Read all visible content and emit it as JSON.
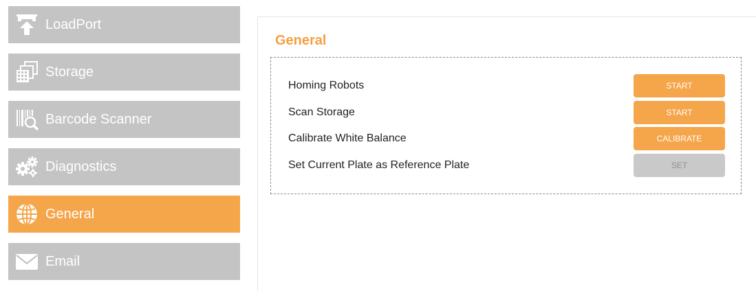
{
  "sidebar": {
    "items": [
      {
        "label": "LoadPort",
        "icon": "upload-icon",
        "active": false
      },
      {
        "label": "Storage",
        "icon": "storage-icon",
        "active": false
      },
      {
        "label": "Barcode Scanner",
        "icon": "barcode-scanner-icon",
        "active": false
      },
      {
        "label": "Diagnostics",
        "icon": "gears-icon",
        "active": false
      },
      {
        "label": "General",
        "icon": "globe-icon",
        "active": true
      },
      {
        "label": "Email",
        "icon": "envelope-icon",
        "active": false
      }
    ]
  },
  "panel": {
    "title": "General",
    "settings": [
      {
        "label": "Homing Robots",
        "button": "START",
        "enabled": true
      },
      {
        "label": "Scan Storage",
        "button": "START",
        "enabled": true
      },
      {
        "label": "Calibrate White Balance",
        "button": "CALIBRATE",
        "enabled": true
      },
      {
        "label": "Set Current Plate as Reference Plate",
        "button": "SET",
        "enabled": false
      }
    ]
  },
  "colors": {
    "accent": "#f5a54a",
    "title": "#f5a042",
    "nav_inactive": "#c4c4c4",
    "button_disabled": "#c9c9c9"
  }
}
